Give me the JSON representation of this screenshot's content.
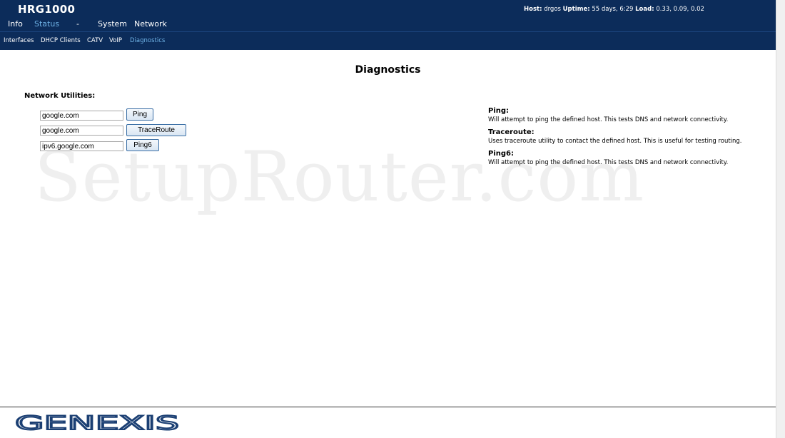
{
  "header": {
    "brand": "HRG1000",
    "host_label": "Host:",
    "host_value": "drgos",
    "uptime_label": "Uptime:",
    "uptime_value": "55 days, 6:29",
    "load_label": "Load:",
    "load_value": "0.33, 0.09, 0.02"
  },
  "topnav": {
    "info": "Info",
    "status": "Status",
    "dash": "-",
    "system": "System",
    "network": "Network"
  },
  "subnav": {
    "interfaces": "Interfaces",
    "dhcp_clients": "DHCP Clients",
    "catv": "CATV",
    "voip": "VoIP",
    "diagnostics": "Diagnostics"
  },
  "main": {
    "title": "Diagnostics",
    "section_title": "Network Utilities:",
    "ping_input": "google.com",
    "ping_button": "Ping",
    "traceroute_input": "google.com",
    "traceroute_button": "TraceRoute",
    "ping6_input": "ipv6.google.com",
    "ping6_button": "Ping6"
  },
  "help": {
    "ping_title": "Ping:",
    "ping_desc": "Will attempt to ping the defined host. This tests DNS and network connectivity.",
    "traceroute_title": "Traceroute:",
    "traceroute_desc": "Uses traceroute utility to contact the defined host. This is useful for testing routing.",
    "ping6_title": "Ping6:",
    "ping6_desc": "Will attempt to ping the defined host. This tests DNS and network connectivity."
  },
  "watermark": "SetupRouter.com",
  "footer": {
    "logo_text": "GENEXIS"
  },
  "colors": {
    "header_bg": "#0c2c5a",
    "active_nav": "#6fb3e6",
    "logo_blue": "#1b3f73"
  }
}
